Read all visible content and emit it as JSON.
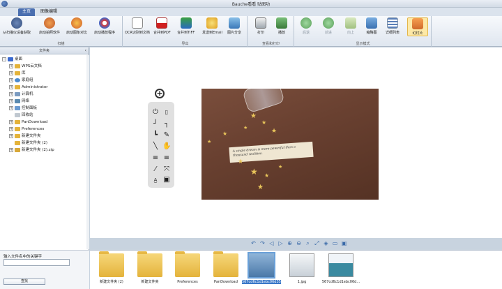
{
  "window": {
    "title": "Bauche看看 贴图功"
  },
  "tabs": [
    {
      "label": "主页"
    },
    {
      "label": "图像编辑"
    }
  ],
  "ribbon": {
    "groups": [
      {
        "label": "扫描"
      },
      {
        "label": "导出"
      },
      {
        "label": "查看和打印"
      },
      {
        "label": "显示模式"
      }
    ],
    "buttons": [
      {
        "label": "从扫描仪设备获取"
      },
      {
        "label": "启动拍照软件"
      },
      {
        "label": "启动图象对比"
      },
      {
        "label": "启动播放程序"
      },
      {
        "label": "OCR识别到文档"
      },
      {
        "label": "合并到PDF"
      },
      {
        "label": "合并到TIFF"
      },
      {
        "label": "发送到Email"
      },
      {
        "label": "图片分享"
      },
      {
        "label": "打印"
      },
      {
        "label": "播放"
      },
      {
        "label": "后退"
      },
      {
        "label": "前进"
      },
      {
        "label": "向上"
      },
      {
        "label": "缩略图"
      },
      {
        "label": "详细列表"
      },
      {
        "label": "幻灯片"
      }
    ]
  },
  "folders_panel": {
    "title": "文件夹",
    "tree": [
      {
        "label": "桌面"
      },
      {
        "label": "WPS云文档"
      },
      {
        "label": "库"
      },
      {
        "label": "家庭组"
      },
      {
        "label": "Administrator"
      },
      {
        "label": "计算机"
      },
      {
        "label": "网络"
      },
      {
        "label": "控制面板"
      },
      {
        "label": "回收站"
      },
      {
        "label": "PanDownload"
      },
      {
        "label": "Preferences"
      },
      {
        "label": "新建文件夹"
      },
      {
        "label": "新建文件夹 (2)"
      },
      {
        "label": "新建文件夹 (2).zip"
      }
    ]
  },
  "search": {
    "label": "输入文件名中的关键字",
    "value": "",
    "button": "查找"
  },
  "photo": {
    "note_text": "A single dream is more powerful than a thousand realities."
  },
  "thumbnails": [
    {
      "caption": "新建文件夹 (2)"
    },
    {
      "caption": "新建文件夹"
    },
    {
      "caption": "Preferences"
    },
    {
      "caption": "PanDownload"
    },
    {
      "caption": "567cd6c1d1ebc06d358a2a59de9b3b4b.jpg"
    },
    {
      "caption": "1.jpg"
    },
    {
      "caption": "567cd6c1d1ebc06d..."
    }
  ],
  "colors": {
    "active_tab": "#4b6fb0",
    "selection": "#3a78c8",
    "folder": "#e4b33b"
  }
}
